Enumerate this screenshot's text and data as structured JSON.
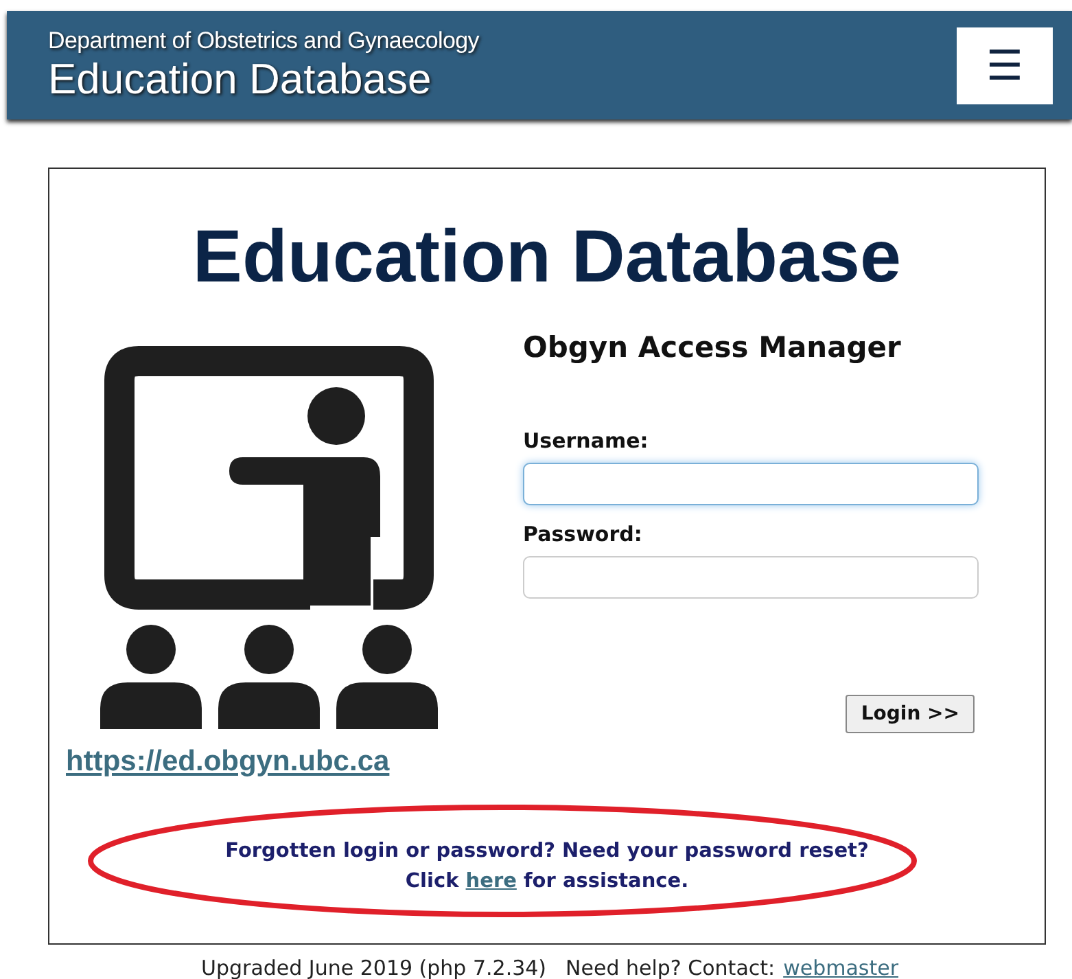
{
  "header": {
    "subtitle": "Department of Obstetrics and Gynaecology",
    "title": "Education Database",
    "menu_button": "☰"
  },
  "card": {
    "heading": "Education Database",
    "site_link": "https://ed.obgyn.ubc.ca",
    "login": {
      "title": "Obgyn Access Manager",
      "fields": [
        {
          "label": "Username:",
          "focused": true
        },
        {
          "label": "Password:",
          "focused": false
        }
      ],
      "button": "Login >>"
    },
    "help": {
      "line1": "Forgotten login or password? Need your password reset?",
      "before": "Click",
      "link": "here",
      "after": "for assistance.",
      "circled": true
    }
  },
  "footer": {
    "note": "Upgraded June 2019 (php 7.2.34)",
    "contact": "Need help? Contact:",
    "link": "webmaster"
  }
}
